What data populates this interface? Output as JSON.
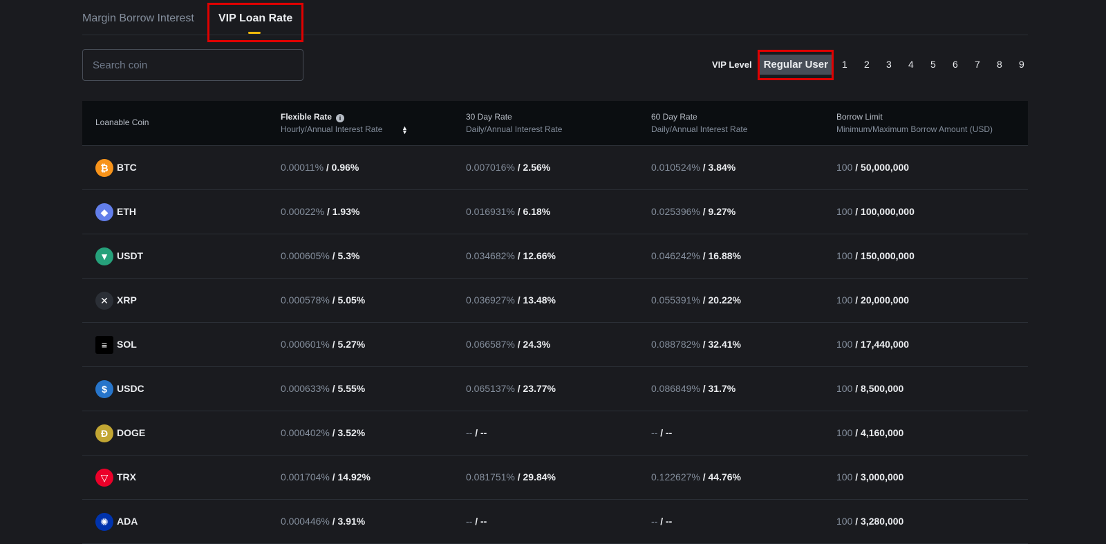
{
  "tabs": [
    {
      "label": "Margin Borrow Interest"
    },
    {
      "label": "VIP Loan Rate"
    }
  ],
  "search": {
    "placeholder": "Search coin"
  },
  "vip": {
    "label": "VIP Level",
    "selected": "Regular User",
    "levels": [
      "1",
      "2",
      "3",
      "4",
      "5",
      "6",
      "7",
      "8",
      "9"
    ]
  },
  "colors": {
    "accent": "#f0b90b",
    "highlight_box": "#e00000"
  },
  "table": {
    "headers": [
      {
        "title": "Loanable Coin",
        "sub": ""
      },
      {
        "title": "Flexible Rate",
        "sub": "Hourly/Annual Interest Rate"
      },
      {
        "title": "30 Day Rate",
        "sub": "Daily/Annual Interest Rate"
      },
      {
        "title": "60 Day Rate",
        "sub": "Daily/Annual Interest Rate"
      },
      {
        "title": "Borrow Limit",
        "sub": "Minimum/Maximum Borrow Amount (USD)"
      }
    ],
    "rows": [
      {
        "coin": "BTC",
        "icon": "btc-icon",
        "color": "#f7931a",
        "flex": [
          "0.00011%",
          "/ 0.96%"
        ],
        "d30": [
          "0.007016%",
          "/ 2.56%"
        ],
        "d60": [
          "0.010524%",
          "/ 3.84%"
        ],
        "limit": [
          "100",
          "/ 50,000,000"
        ]
      },
      {
        "coin": "ETH",
        "icon": "eth-icon",
        "color": "#627eea",
        "flex": [
          "0.00022%",
          "/ 1.93%"
        ],
        "d30": [
          "0.016931%",
          "/ 6.18%"
        ],
        "d60": [
          "0.025396%",
          "/ 9.27%"
        ],
        "limit": [
          "100",
          "/ 100,000,000"
        ]
      },
      {
        "coin": "USDT",
        "icon": "usdt-icon",
        "color": "#26a17b",
        "flex": [
          "0.000605%",
          "/ 5.3%"
        ],
        "d30": [
          "0.034682%",
          "/ 12.66%"
        ],
        "d60": [
          "0.046242%",
          "/ 16.88%"
        ],
        "limit": [
          "100",
          "/ 150,000,000"
        ]
      },
      {
        "coin": "XRP",
        "icon": "xrp-icon",
        "color": "#2b2f36",
        "flex": [
          "0.000578%",
          "/ 5.05%"
        ],
        "d30": [
          "0.036927%",
          "/ 13.48%"
        ],
        "d60": [
          "0.055391%",
          "/ 20.22%"
        ],
        "limit": [
          "100",
          "/ 20,000,000"
        ]
      },
      {
        "coin": "SOL",
        "icon": "sol-icon",
        "color": "#000000",
        "flex": [
          "0.000601%",
          "/ 5.27%"
        ],
        "d30": [
          "0.066587%",
          "/ 24.3%"
        ],
        "d60": [
          "0.088782%",
          "/ 32.41%"
        ],
        "limit": [
          "100",
          "/ 17,440,000"
        ]
      },
      {
        "coin": "USDC",
        "icon": "usdc-icon",
        "color": "#2775ca",
        "flex": [
          "0.000633%",
          "/ 5.55%"
        ],
        "d30": [
          "0.065137%",
          "/ 23.77%"
        ],
        "d60": [
          "0.086849%",
          "/ 31.7%"
        ],
        "limit": [
          "100",
          "/ 8,500,000"
        ]
      },
      {
        "coin": "DOGE",
        "icon": "doge-icon",
        "color": "#c2a633",
        "flex": [
          "0.000402%",
          "/ 3.52%"
        ],
        "d30": [
          "--",
          "/ --"
        ],
        "d60": [
          "--",
          "/ --"
        ],
        "limit": [
          "100",
          "/ 4,160,000"
        ]
      },
      {
        "coin": "TRX",
        "icon": "trx-icon",
        "color": "#eb0029",
        "flex": [
          "0.001704%",
          "/ 14.92%"
        ],
        "d30": [
          "0.081751%",
          "/ 29.84%"
        ],
        "d60": [
          "0.122627%",
          "/ 44.76%"
        ],
        "limit": [
          "100",
          "/ 3,000,000"
        ]
      },
      {
        "coin": "ADA",
        "icon": "ada-icon",
        "color": "#0033ad",
        "flex": [
          "0.000446%",
          "/ 3.91%"
        ],
        "d30": [
          "--",
          "/ --"
        ],
        "d60": [
          "--",
          "/ --"
        ],
        "limit": [
          "100",
          "/ 3,280,000"
        ]
      }
    ]
  }
}
